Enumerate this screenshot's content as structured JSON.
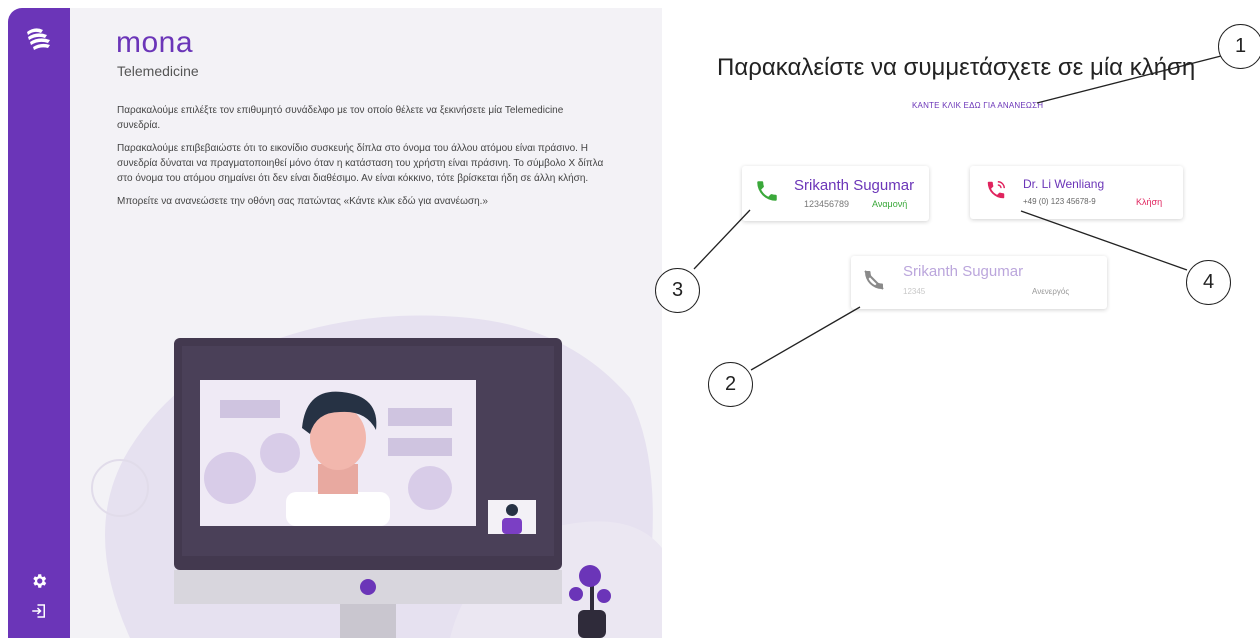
{
  "app": {
    "brand": "mona",
    "brand_sub": "Telemedicine"
  },
  "sidebar": {
    "icons": [
      "mona-logo-icon",
      "gear-icon",
      "logout-icon"
    ]
  },
  "info": {
    "p1": "Παρακαλούμε επιλέξτε τον επιθυμητό συνάδελφο με τον οποίο θέλετε να ξεκινήσετε μία Telemedicine συνεδρία.",
    "p2": "Παρακαλούμε επιβεβαιώστε ότι το εικονίδιο συσκευής δίπλα στο όνομα του άλλου ατόμου είναι πράσινο. Η συνεδρία δύναται να πραγματοποιηθεί μόνο όταν η κατάσταση του χρήστη είναι πράσινη. Το σύμβολο Χ δίπλα στο όνομα του ατόμου σημαίνει ότι δεν είναι διαθέσιμο. Αν είναι κόκκινο, τότε βρίσκεται ήδη σε άλλη κλήση.",
    "p3": "Μπορείτε να ανανεώσετε την οθόνη σας πατώντας «Κάντε κλικ εδώ για ανανέωση.»"
  },
  "main": {
    "heading": "Παρακαλείστε να συμμετάσχετε σε μία κλήση",
    "refresh_label": "ΚΑΝΤΕ ΚΛΙΚ ΕΔΩ ΓΙΑ ΑΝΑΝΕΩΣΗ"
  },
  "contacts": [
    {
      "name": "Srikanth Sugumar",
      "number": "123456789",
      "status": "Αναμονή",
      "status_color": "#3aa83a",
      "icon": "phone-icon"
    },
    {
      "name": "Dr. Li Wenliang",
      "number": "+49 (0) 123 45678-9",
      "status": "Κλήση",
      "status_color": "#e0245e",
      "icon": "phone-ringing-icon"
    },
    {
      "name": "Srikanth Sugumar",
      "number": "12345",
      "status": "Ανενεργός",
      "status_color": "#999999",
      "icon": "phone-disabled-icon"
    }
  ],
  "callouts": [
    "1",
    "2",
    "3",
    "4"
  ],
  "colors": {
    "accent": "#6b35b8",
    "available": "#3aa83a",
    "busy": "#e0245e",
    "inactive": "#999999"
  }
}
